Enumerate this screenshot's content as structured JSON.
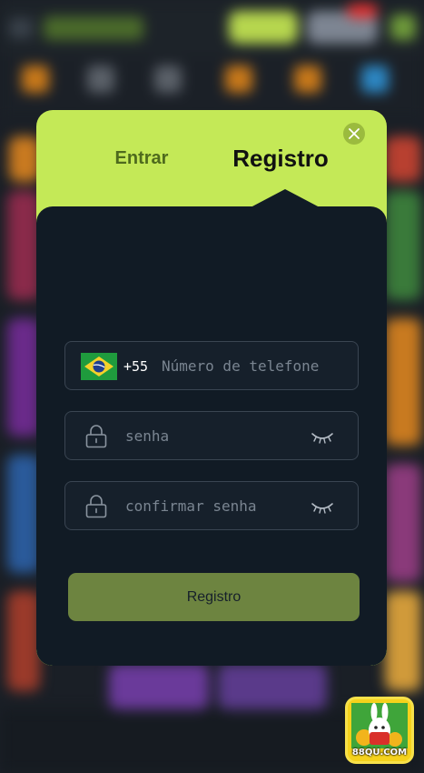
{
  "modal": {
    "tabs": {
      "login": "Entrar",
      "register": "Registro"
    },
    "phone": {
      "country_code": "+55",
      "placeholder": "Número de telefone"
    },
    "password": {
      "placeholder": "senha"
    },
    "confirm_password": {
      "placeholder": "confirmar senha"
    },
    "submit_label": "Registro"
  },
  "app_badge": {
    "label": "88QU.COM"
  },
  "colors": {
    "accent": "#c4e957",
    "panel": "#111b25",
    "button": "#6d8440"
  },
  "icons": [
    "close-icon",
    "brazil-flag-icon",
    "lock-icon",
    "eye-closed-icon"
  ]
}
